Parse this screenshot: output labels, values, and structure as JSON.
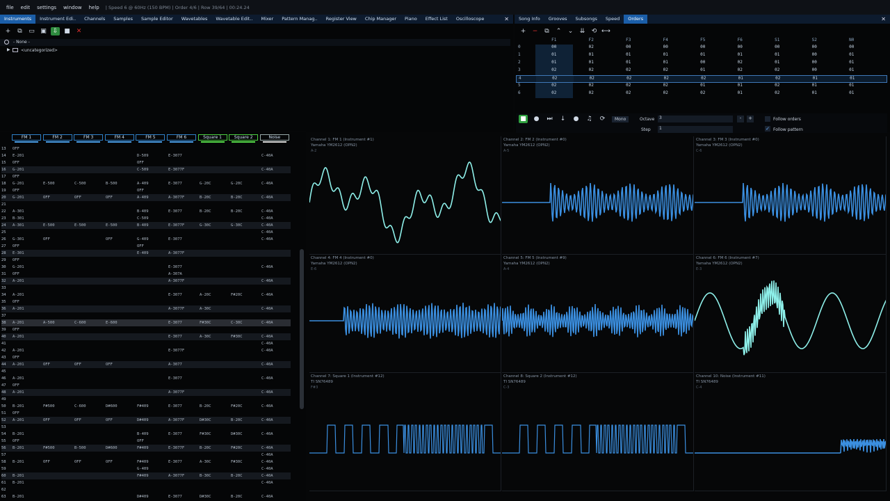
{
  "menu": [
    "file",
    "edit",
    "settings",
    "window",
    "help"
  ],
  "status": "| Speed 6 @ 60Hz (150 BPM) | Order 4/6 | Row 39/64 | 00:24.24",
  "left_tabs": [
    "Instruments",
    "Instrument Edi..",
    "Channels",
    "Samples",
    "Sample Editor",
    "Wavetables",
    "Wavetable Edit..",
    "Mixer",
    "Pattern Manag..",
    "Register View",
    "Chip Manager",
    "Piano",
    "Effect List",
    "Oscilloscope"
  ],
  "right_tabs": [
    "Song Info",
    "Grooves",
    "Subsongs",
    "Speed",
    "Orders"
  ],
  "close_glyph": "✕",
  "instruments": {
    "none": "- None -",
    "folder": "<uncategorized>"
  },
  "orders": {
    "headers": [
      "F1",
      "F2",
      "F3",
      "F4",
      "F5",
      "F6",
      "S1",
      "S2",
      "N0"
    ],
    "rows": [
      {
        "n": "0",
        "v": [
          "00",
          "02",
          "00",
          "00",
          "00",
          "00",
          "00",
          "00",
          "00"
        ]
      },
      {
        "n": "1",
        "v": [
          "01",
          "01",
          "01",
          "01",
          "01",
          "01",
          "01",
          "00",
          "01"
        ]
      },
      {
        "n": "2",
        "v": [
          "01",
          "01",
          "01",
          "01",
          "00",
          "02",
          "01",
          "00",
          "01"
        ]
      },
      {
        "n": "3",
        "v": [
          "02",
          "02",
          "02",
          "02",
          "01",
          "02",
          "02",
          "00",
          "01"
        ]
      },
      {
        "n": "4",
        "v": [
          "02",
          "02",
          "02",
          "02",
          "02",
          "01",
          "02",
          "01",
          "01"
        ]
      },
      {
        "n": "5",
        "v": [
          "02",
          "02",
          "02",
          "02",
          "01",
          "01",
          "02",
          "01",
          "01"
        ]
      },
      {
        "n": "6",
        "v": [
          "02",
          "02",
          "02",
          "02",
          "02",
          "01",
          "02",
          "01",
          "01"
        ]
      }
    ],
    "selected_row": 4
  },
  "playback": {
    "mono": "Mono",
    "octave_label": "Octave",
    "octave": "3",
    "step_label": "Step",
    "step": "1",
    "follow_orders": "Follow orders",
    "follow_pattern": "Follow pattern"
  },
  "pattern": {
    "channels": [
      {
        "name": "FM 1",
        "kind": "fm"
      },
      {
        "name": "FM 2",
        "kind": "fm"
      },
      {
        "name": "FM 3",
        "kind": "fm"
      },
      {
        "name": "FM 4",
        "kind": "fm"
      },
      {
        "name": "FM 5",
        "kind": "fm"
      },
      {
        "name": "FM 6",
        "kind": "fm"
      },
      {
        "name": "Square 1",
        "kind": "sq"
      },
      {
        "name": "Square 2",
        "kind": "sq"
      },
      {
        "name": "Noise",
        "kind": "nz"
      }
    ],
    "rows": [
      {
        "n": "13",
        "c": [
          "OFF",
          "",
          "",
          "",
          "",
          "",
          "",
          "",
          ""
        ]
      },
      {
        "n": "14",
        "c": [
          "E-201",
          "",
          "",
          "",
          "D-509",
          "E-3077",
          "",
          "",
          "C-40A"
        ]
      },
      {
        "n": "15",
        "c": [
          "OFF",
          "",
          "",
          "",
          "OFF",
          "",
          "",
          "",
          ""
        ]
      },
      {
        "n": "16",
        "c": [
          "G-201",
          "",
          "",
          "",
          "C-509",
          "E-3077F",
          "",
          "",
          "C-40A"
        ]
      },
      {
        "n": "17",
        "c": [
          "OFF",
          "",
          "",
          "",
          "",
          "",
          "",
          "",
          ""
        ]
      },
      {
        "n": "18",
        "c": [
          "G-201",
          "E-500",
          "C-500",
          "B-500",
          "A-409",
          "E-3077",
          "G-20C",
          "G-20C",
          "C-40A"
        ]
      },
      {
        "n": "19",
        "c": [
          "OFF",
          "",
          "",
          "",
          "OFF",
          "",
          "",
          "",
          ""
        ]
      },
      {
        "n": "20",
        "c": [
          "G-201",
          "OFF",
          "OFF",
          "OFF",
          "A-409",
          "A-3077F",
          "B-20C",
          "B-20C",
          "C-40A"
        ]
      },
      {
        "n": "21",
        "c": [
          "",
          "",
          "",
          "",
          "",
          "",
          "",
          "",
          ""
        ]
      },
      {
        "n": "22",
        "c": [
          "A-301",
          "",
          "",
          "",
          "B-409",
          "E-3077",
          "B-20C",
          "B-20C",
          "C-40A"
        ]
      },
      {
        "n": "23",
        "c": [
          "B-301",
          "",
          "",
          "",
          "C-509",
          "",
          "",
          "",
          "C-40A"
        ]
      },
      {
        "n": "24",
        "c": [
          "A-301",
          "E-500",
          "E-500",
          "E-500",
          "B-409",
          "E-3077F",
          "G-30C",
          "G-30C",
          "C-40A"
        ]
      },
      {
        "n": "25",
        "c": [
          "",
          "",
          "",
          "",
          "",
          "",
          "",
          "",
          "C-40A"
        ]
      },
      {
        "n": "26",
        "c": [
          "G-301",
          "OFF",
          "",
          "OFF",
          "G-409",
          "E-3077",
          "",
          "",
          "C-40A"
        ]
      },
      {
        "n": "27",
        "c": [
          "OFF",
          "",
          "",
          "",
          "OFF",
          "",
          "",
          "",
          ""
        ]
      },
      {
        "n": "28",
        "c": [
          "E-301",
          "",
          "",
          "",
          "E-409",
          "A-3077F",
          "",
          "",
          ""
        ]
      },
      {
        "n": "29",
        "c": [
          "OFF",
          "",
          "",
          "",
          "",
          "",
          "",
          "",
          ""
        ]
      },
      {
        "n": "30",
        "c": [
          "G-201",
          "",
          "",
          "",
          "",
          "E-3077",
          "",
          "",
          "C-40A"
        ]
      },
      {
        "n": "31",
        "c": [
          "OFF",
          "",
          "",
          "",
          "",
          "A-307A",
          "",
          "",
          ""
        ]
      },
      {
        "n": "32",
        "c": [
          "A-201",
          "",
          "",
          "",
          "",
          "A-3077F",
          "",
          "",
          "C-40A"
        ]
      },
      {
        "n": "33",
        "c": [
          "",
          "",
          "",
          "",
          "",
          "",
          "",
          "",
          ""
        ]
      },
      {
        "n": "34",
        "c": [
          "A-201",
          "",
          "",
          "",
          "",
          "E-3077",
          "A-20C",
          "F#20C",
          "C-40A"
        ]
      },
      {
        "n": "35",
        "c": [
          "OFF",
          "",
          "",
          "",
          "",
          "",
          "",
          "",
          ""
        ]
      },
      {
        "n": "36",
        "c": [
          "A-201",
          "",
          "",
          "",
          "",
          "A-3077F",
          "A-30C",
          "",
          "C-40A"
        ]
      },
      {
        "n": "37",
        "c": [
          "",
          "",
          "",
          "",
          "",
          "",
          "",
          "",
          ""
        ]
      },
      {
        "n": "38",
        "c": [
          "A-201",
          "A-500",
          "C-600",
          "E-600",
          "",
          "E-3077",
          "F#30C",
          "C-30C",
          "C-40A"
        ]
      },
      {
        "n": "39",
        "c": [
          "OFF",
          "",
          "",
          "",
          "",
          "",
          "",
          "",
          ""
        ]
      },
      {
        "n": "40",
        "c": [
          "A-201",
          "",
          "",
          "",
          "",
          "E-3077",
          "A-30C",
          "F#30C",
          "C-40A"
        ]
      },
      {
        "n": "41",
        "c": [
          "",
          "",
          "",
          "",
          "",
          "",
          "",
          "",
          "C-40A"
        ]
      },
      {
        "n": "42",
        "c": [
          "A-201",
          "",
          "",
          "",
          "",
          "E-3077F",
          "",
          "",
          "C-40A"
        ]
      },
      {
        "n": "43",
        "c": [
          "OFF",
          "",
          "",
          "",
          "",
          "",
          "",
          "",
          ""
        ]
      },
      {
        "n": "44",
        "c": [
          "A-201",
          "OFF",
          "OFF",
          "OFF",
          "",
          "A-3077",
          "",
          "",
          "C-40A"
        ]
      },
      {
        "n": "45",
        "c": [
          "",
          "",
          "",
          "",
          "",
          "",
          "",
          "",
          ""
        ]
      },
      {
        "n": "46",
        "c": [
          "A-201",
          "",
          "",
          "",
          "",
          "E-3077",
          "",
          "",
          "C-40A"
        ]
      },
      {
        "n": "47",
        "c": [
          "OFF",
          "",
          "",
          "",
          "",
          "",
          "",
          "",
          ""
        ]
      },
      {
        "n": "48",
        "c": [
          "A-201",
          "",
          "",
          "",
          "",
          "A-3077F",
          "",
          "",
          "C-40A"
        ]
      },
      {
        "n": "49",
        "c": [
          "",
          "",
          "",
          "",
          "",
          "",
          "",
          "",
          ""
        ]
      },
      {
        "n": "50",
        "c": [
          "B-201",
          "F#500",
          "C-600",
          "D#600",
          "F#409",
          "E-3077",
          "B-20C",
          "F#20C",
          "C-40A"
        ]
      },
      {
        "n": "51",
        "c": [
          "OFF",
          "",
          "",
          "",
          "",
          "",
          "",
          "",
          ""
        ]
      },
      {
        "n": "52",
        "c": [
          "A-201",
          "OFF",
          "OFF",
          "OFF",
          "D#409",
          "A-3077F",
          "D#30C",
          "B-20C",
          "C-40A"
        ]
      },
      {
        "n": "53",
        "c": [
          "",
          "",
          "",
          "",
          "",
          "",
          "",
          "",
          ""
        ]
      },
      {
        "n": "54",
        "c": [
          "B-201",
          "",
          "",
          "",
          "B-409",
          "E-3077",
          "F#30C",
          "D#30C",
          "C-40A"
        ]
      },
      {
        "n": "55",
        "c": [
          "OFF",
          "",
          "",
          "",
          "OFF",
          "",
          "",
          "",
          ""
        ]
      },
      {
        "n": "56",
        "c": [
          "B-201",
          "F#500",
          "B-500",
          "D#600",
          "F#409",
          "E-3077F",
          "B-20C",
          "F#20C",
          "C-40A"
        ]
      },
      {
        "n": "57",
        "c": [
          "",
          "",
          "",
          "",
          "",
          "",
          "",
          "",
          "C-40A"
        ]
      },
      {
        "n": "58",
        "c": [
          "B-201",
          "OFF",
          "OFF",
          "OFF",
          "F#409",
          "E-3077",
          "A-30C",
          "F#30C",
          "C-40A"
        ]
      },
      {
        "n": "59",
        "c": [
          "",
          "",
          "",
          "",
          "G-409",
          "",
          "",
          "",
          "C-40A"
        ]
      },
      {
        "n": "60",
        "c": [
          "B-201",
          "",
          "",
          "",
          "F#409",
          "A-3077F",
          "B-30C",
          "B-20C",
          "C-40A"
        ]
      },
      {
        "n": "61",
        "c": [
          "B-201",
          "",
          "",
          "",
          "",
          "",
          "",
          "",
          "C-40A"
        ]
      },
      {
        "n": "62",
        "c": [
          "",
          "",
          "",
          "",
          "",
          "",
          "",
          "",
          ""
        ]
      },
      {
        "n": "63",
        "c": [
          "B-201",
          "",
          "",
          "",
          "D#409",
          "E-3077",
          "D#30C",
          "B-20C",
          "C-40A"
        ]
      }
    ],
    "current_row": "38"
  },
  "scopes": [
    {
      "title": "Channel 1: FM 1 (Instrument #1)",
      "chip": "Yamaha YM2612 (OPN2)",
      "note": "A-2",
      "color": "#8ef0ea"
    },
    {
      "title": "Channel 2: FM 2 (Instrument #0)",
      "chip": "Yamaha YM2612 (OPN2)",
      "note": "A-5",
      "color": "#3b8fe0"
    },
    {
      "title": "Channel 3: FM 3 (Instrument #0)",
      "chip": "Yamaha YM2612 (OPN2)",
      "note": "C-6",
      "color": "#3b8fe0"
    },
    {
      "title": "Channel 4: FM 4 (Instrument #0)",
      "chip": "Yamaha YM2612 (OPN2)",
      "note": "E-6",
      "color": "#3b8fe0"
    },
    {
      "title": "Channel 5: FM 5 (Instrument #9)",
      "chip": "Yamaha YM2612 (OPN2)",
      "note": "A-4",
      "color": "#3b8fe0"
    },
    {
      "title": "Channel 6: FM 6 (Instrument #7)",
      "chip": "Yamaha YM2612 (OPN2)",
      "note": "E-3",
      "color": "#8ef0ea"
    },
    {
      "title": "Channel 7: Square 1 (Instrument #12)",
      "chip": "TI SN76489",
      "note": "F#3",
      "color": "#3b8fe0"
    },
    {
      "title": "Channel 8: Square 2 (Instrument #12)",
      "chip": "TI SN76489",
      "note": "C-3",
      "color": "#3b8fe0"
    },
    {
      "title": "Channel 10: Noise (Instrument #11)",
      "chip": "TI SN76489",
      "note": "C-4",
      "color": "#3b8fe0"
    }
  ]
}
